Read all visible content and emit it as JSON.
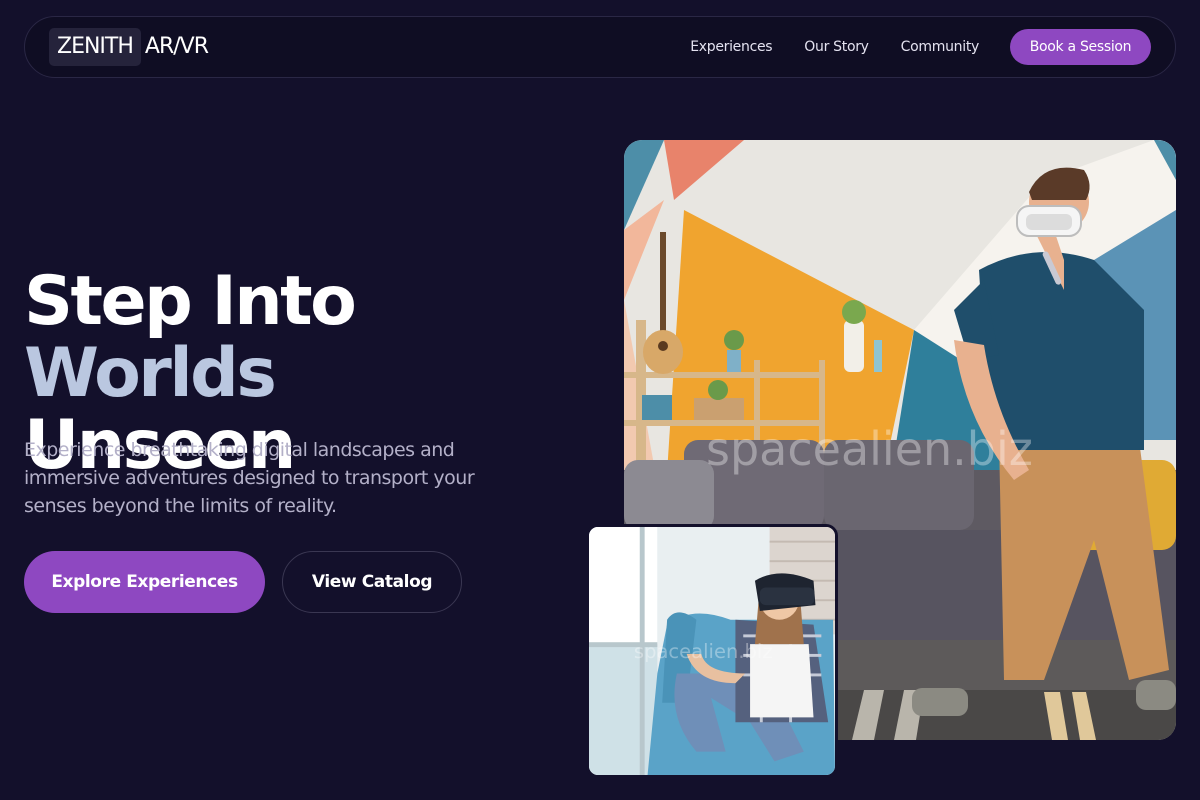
{
  "brand": {
    "logo_boxed": "ZENITH",
    "logo_rest": "AR/VR"
  },
  "nav": {
    "links": [
      "Experiences",
      "Our Story",
      "Community"
    ],
    "cta": "Book a Session"
  },
  "hero": {
    "title_line1_part1": "Step Into ",
    "title_line1_accent": "Worlds",
    "title_line2": "Unseen",
    "subtitle": "Experience breathtaking digital landscapes and immersive adventures designed to transport your senses beyond the limits of reality.",
    "primary_button": "Explore Experiences",
    "secondary_button": "View Catalog"
  },
  "images": {
    "main_watermark": "spacealien.biz",
    "small_watermark": "spacealien.biz"
  },
  "colors": {
    "background": "#13102b",
    "accent_purple": "#8e48c1",
    "title_accent": "#bac7e0"
  }
}
